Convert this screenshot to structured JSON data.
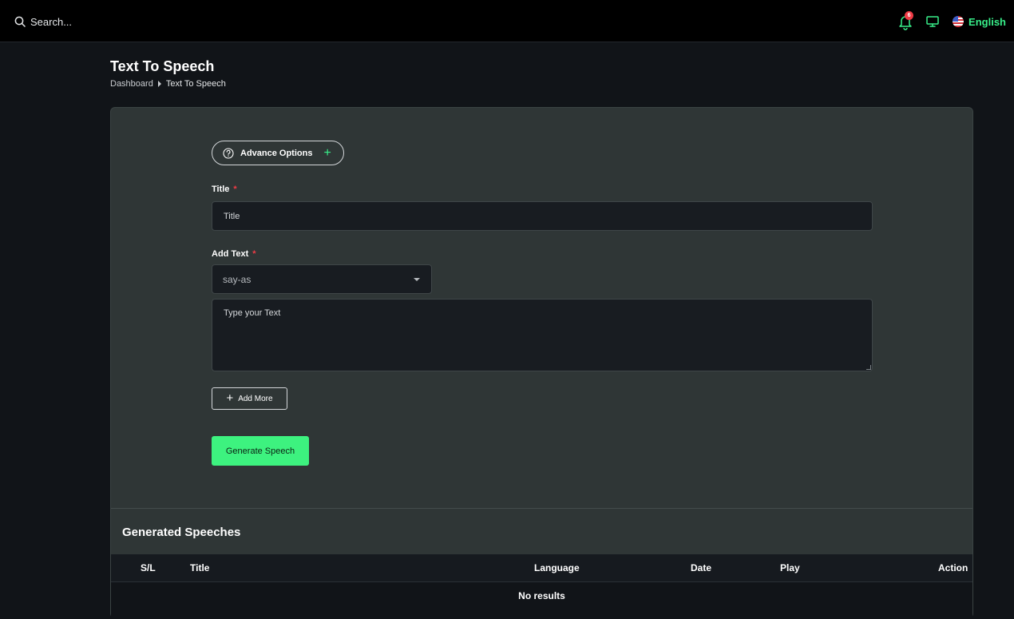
{
  "topbar": {
    "search_placeholder": "Search...",
    "notification_count": "6",
    "language": "English"
  },
  "page": {
    "title": "Text To Speech",
    "breadcrumb": [
      "Dashboard",
      "Text To Speech"
    ]
  },
  "form": {
    "advance_options_label": "Advance Options",
    "title_label": "Title",
    "title_required_mark": "*",
    "title_placeholder": "Title",
    "add_text_label": "Add Text",
    "add_text_required_mark": "*",
    "select_value": "say-as",
    "textarea_placeholder": "Type your Text",
    "add_more_label": "Add More",
    "generate_label": "Generate Speech"
  },
  "speeches": {
    "section_title": "Generated Speeches",
    "columns": [
      "S/L",
      "Title",
      "Language",
      "Date",
      "Play",
      "Action"
    ],
    "empty_text": "No results"
  },
  "colors": {
    "accent": "#3df27f",
    "required": "#ef3b45",
    "card_bg": "#2f3636",
    "page_bg": "#111418"
  }
}
